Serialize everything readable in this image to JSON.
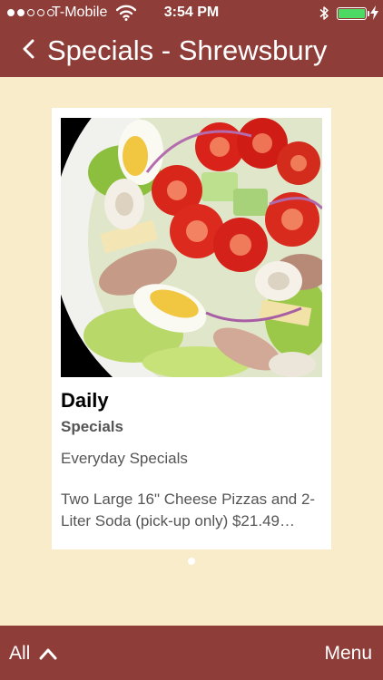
{
  "status_bar": {
    "carrier": "T-Mobile",
    "time": "3:54 PM",
    "signal_strength": 2,
    "signal_max": 5,
    "battery_level": 1.0,
    "icons": [
      "signal-icon",
      "wifi-icon",
      "bluetooth-icon",
      "battery-icon",
      "charging-icon"
    ]
  },
  "nav": {
    "title": "Specials - Shrewsbury",
    "back_icon": "chevron-left-icon"
  },
  "card": {
    "title": "Daily",
    "subtitle": "Specials",
    "category": "Everyday Specials",
    "description": "Two Large 16\" Cheese Pizzas and 2-Liter Soda (pick-up only) $21.49…"
  },
  "pager": {
    "current": 1,
    "total": 1
  },
  "bottom_bar": {
    "left_label": "All",
    "left_icon": "chevron-up-icon",
    "right_label": "Menu"
  },
  "colors": {
    "bar": "#8f3d38",
    "background": "#f9eccb",
    "card": "#ffffff",
    "battery": "#4cd964"
  }
}
